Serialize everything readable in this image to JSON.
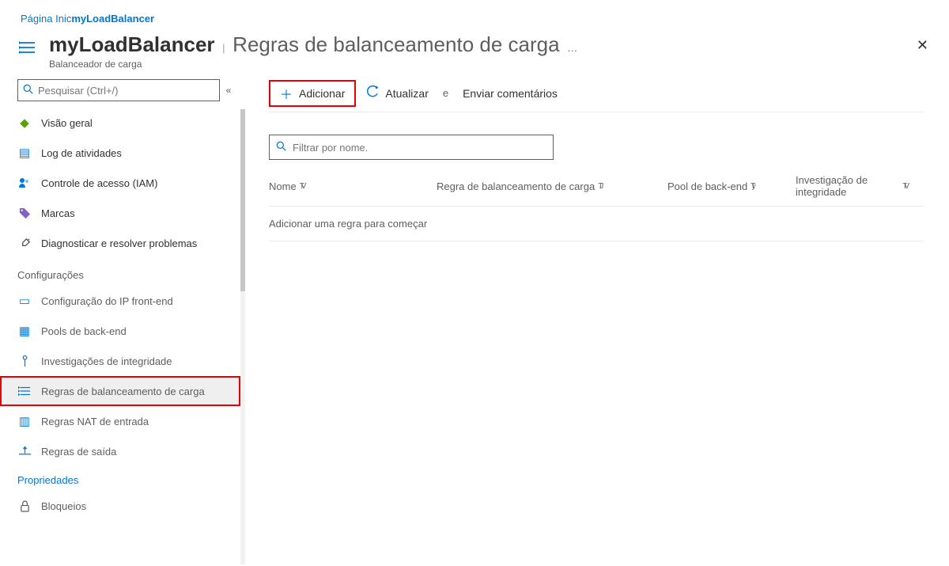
{
  "breadcrumb": {
    "home": "Página Inic",
    "resource": "myLoadBalancer"
  },
  "header": {
    "title": "myLoadBalancer",
    "subtitle": "Regras de balanceamento de carga",
    "resourceType": "Balanceador de carga"
  },
  "sidebar": {
    "searchPlaceholder": "Pesquisar (Ctrl+/)",
    "items": {
      "overview": "Visão geral",
      "activity": "Log de atividades",
      "iam": "Controle de acesso (IAM)",
      "tags": "Marcas",
      "diag": "Diagnosticar e resolver problemas"
    },
    "sectionSettings": "Configurações",
    "settings": {
      "frontendip": "Configuração do IP front-end",
      "backendpools": "Pools de back-end",
      "probes": "Investigações de integridade",
      "lbrules": "Regras de balanceamento de carga",
      "natrules": "Regras NAT de entrada",
      "outbound": "Regras de saída"
    },
    "propertiesLink": "Propriedades",
    "locks": "Bloqueios"
  },
  "toolbar": {
    "add": "Adicionar",
    "refresh": "Atualizar",
    "feedback": "Enviar comentários"
  },
  "filter": {
    "placeholder": "Filtrar por nome."
  },
  "columns": {
    "name": "Nome",
    "rule": "Regra de balanceamento de carga",
    "pool": "Pool de back-end",
    "probe": "Investigação de integridade"
  },
  "sortGlyphs": {
    "both": "TV",
    "alt": "TJ",
    "alt2": "Ty"
  },
  "table": {
    "empty": "Adicionar uma regra para começar"
  }
}
